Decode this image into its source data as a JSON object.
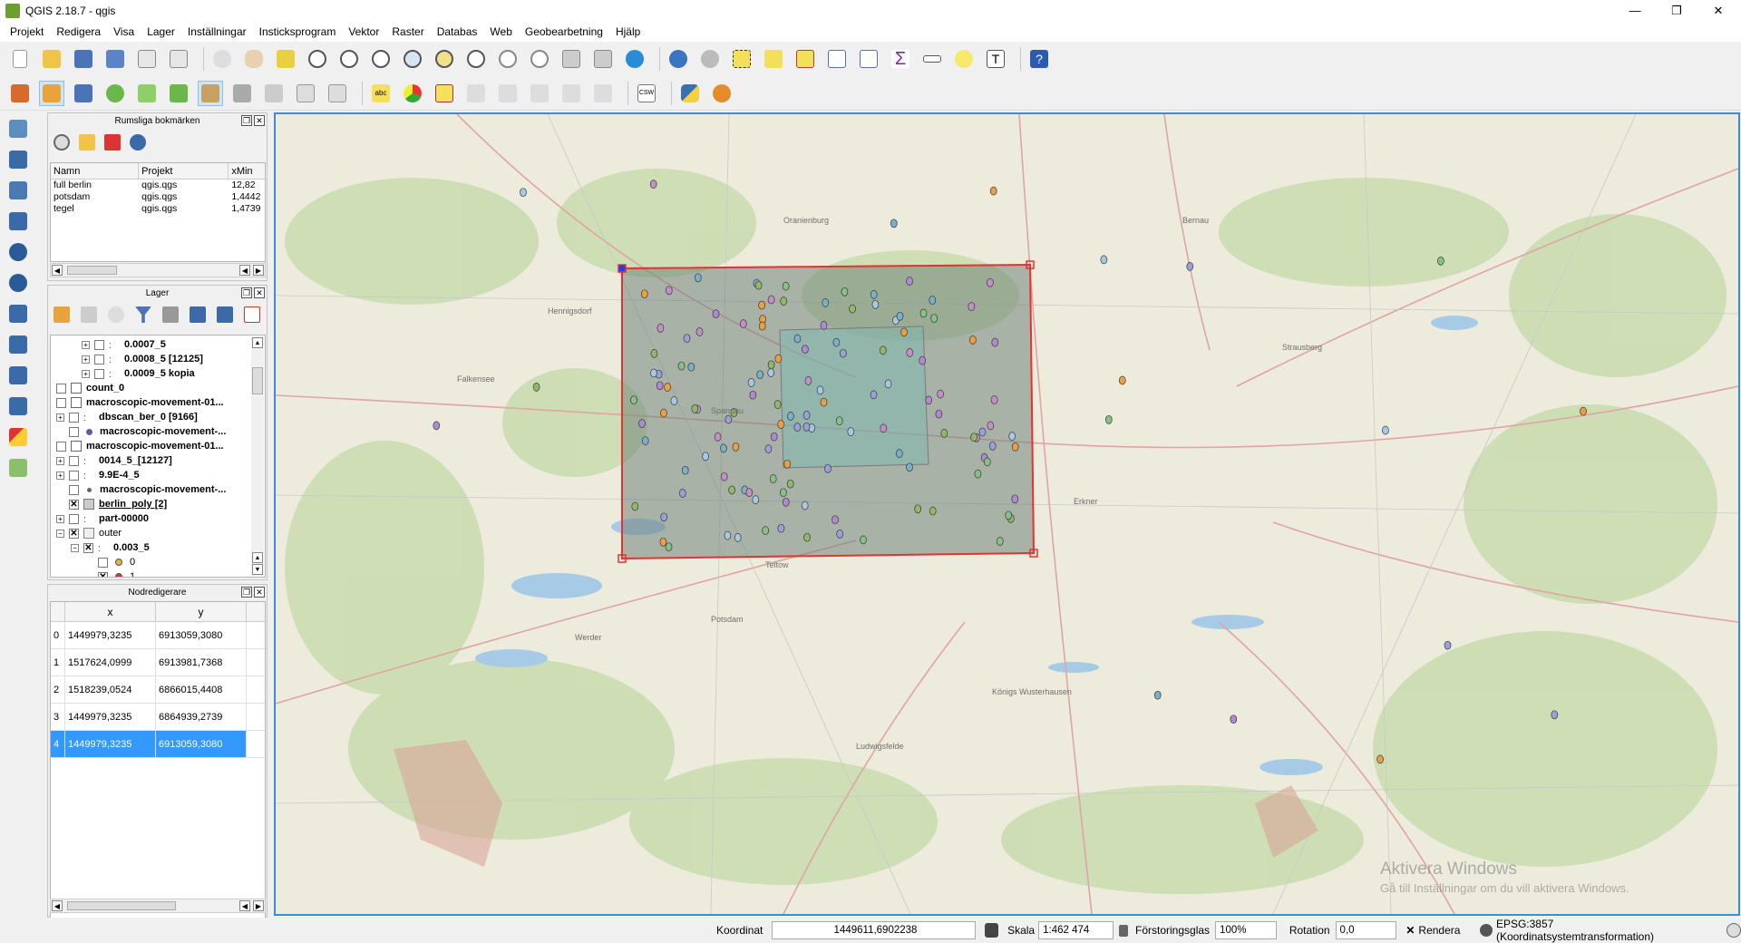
{
  "window": {
    "title": "QGIS 2.18.7 - qgis",
    "minimize": "—",
    "maximize": "❐",
    "close": "✕"
  },
  "menu": [
    "Projekt",
    "Redigera",
    "Visa",
    "Lager",
    "Inställningar",
    "Insticksprogram",
    "Vektor",
    "Raster",
    "Databas",
    "Web",
    "Geobearbetning",
    "Hjälp"
  ],
  "colors": {
    "selection": "#3399ff",
    "polygon_outline": "#e8312f",
    "accent_blue": "#3a8ed8"
  },
  "bookmarks_panel": {
    "title": "Rumsliga bokmärken",
    "columns": [
      "Namn",
      "Projekt",
      "xMin"
    ],
    "rows": [
      {
        "name": "full berlin",
        "project": "qgis.qgs",
        "xmin": "12,82"
      },
      {
        "name": "potsdam",
        "project": "qgis.qgs",
        "xmin": "1,4442"
      },
      {
        "name": "tegel",
        "project": "qgis.qgs",
        "xmin": "1,4739"
      }
    ]
  },
  "layers_panel": {
    "title": "Lager",
    "items": [
      {
        "label": "0.0007_5",
        "bold": true
      },
      {
        "label": "0.0008_5 [12125]",
        "bold": true
      },
      {
        "label": "0.0009_5 kopia",
        "bold": true
      },
      {
        "label": "count_0",
        "bold": true
      },
      {
        "label": "macroscopic-movement-01...",
        "bold": true
      },
      {
        "label": "dbscan_ber_0 [9166]",
        "bold": true
      },
      {
        "label": "macroscopic-movement-...",
        "bold": true
      },
      {
        "label": "macroscopic-movement-01...",
        "bold": true
      },
      {
        "label": "0014_5_[12127]",
        "bold": true
      },
      {
        "label": "9.9E-4_5",
        "bold": true
      },
      {
        "label": "macroscopic-movement-...",
        "bold": true
      },
      {
        "label": "berlin_poly [2]",
        "bold": true
      },
      {
        "label": "part-00000",
        "bold": true
      },
      {
        "label": "outer",
        "bold": false
      },
      {
        "label": "0.003_5",
        "bold": true
      },
      {
        "label": "0",
        "bold": false
      },
      {
        "label": "1",
        "bold": false
      }
    ]
  },
  "node_editor": {
    "title": "Nodredigerare",
    "columns": [
      "x",
      "y"
    ],
    "rows": [
      {
        "idx": "0",
        "x": "1449979,3235",
        "y": "6913059,3080"
      },
      {
        "idx": "1",
        "x": "1517624,0999",
        "y": "6913981,7368"
      },
      {
        "idx": "2",
        "x": "1518239,0524",
        "y": "6866015,4408"
      },
      {
        "idx": "3",
        "x": "1449979,3235",
        "y": "6864939,2739"
      },
      {
        "idx": "4",
        "x": "1449979,3235",
        "y": "6913059,3080"
      }
    ],
    "selected_row": 4
  },
  "map": {
    "places": [
      "Falkensee",
      "Spandau",
      "Oranienburg",
      "Bernau",
      "Potsdam",
      "Werder",
      "Königs Wusterhausen",
      "Erkner",
      "Strausberg",
      "Hennigsdorf",
      "Ludwigsfelde",
      "Teltow"
    ],
    "watermark_line1": "Aktivera Windows",
    "watermark_line2": "Gå till Inställningar om du vill aktivera Windows."
  },
  "statusbar": {
    "coord_label": "Koordinat",
    "coord_value": "1449611,6902238",
    "scale_label": "Skala",
    "scale_value": "1:462 474",
    "magnifier_label": "Förstoringsglas",
    "magnifier_value": "100%",
    "rotation_label": "Rotation",
    "rotation_value": "0,0",
    "render_label": "Rendera",
    "crs_label": "EPSG:3857 (Koordinatsystemtransformation)"
  }
}
